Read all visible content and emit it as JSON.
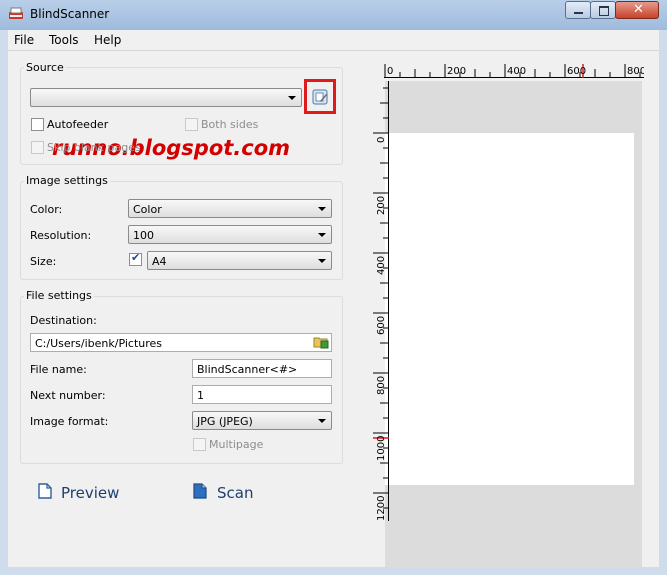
{
  "window": {
    "title": "BlindScanner"
  },
  "menu": [
    "File",
    "Tools",
    "Help"
  ],
  "source": {
    "group_label": "Source",
    "device_value": "",
    "autofeeder_label": "Autofeeder",
    "autofeeder_checked": false,
    "both_sides_label": "Both sides",
    "both_sides_checked": false,
    "skip_blank_label": "Skip blank pages",
    "skip_blank_checked": false
  },
  "image_settings": {
    "group_label": "Image settings",
    "color_label": "Color:",
    "color_value": "Color",
    "resolution_label": "Resolution:",
    "resolution_value": "100",
    "size_label": "Size:",
    "size_checked": true,
    "size_value": "A4"
  },
  "file_settings": {
    "group_label": "File settings",
    "destination_label": "Destination:",
    "destination_value": "C:/Users/ibenk/Pictures",
    "file_name_label": "File name:",
    "file_name_value": "BlindScanner<#>",
    "next_number_label": "Next number:",
    "next_number_value": "1",
    "image_format_label": "Image format:",
    "image_format_value": "JPG (JPEG)",
    "multipage_label": "Multipage",
    "multipage_checked": false
  },
  "actions": {
    "preview_label": "Preview",
    "scan_label": "Scan"
  },
  "ruler": {
    "h_labels": [
      "0",
      "200",
      "400",
      "600",
      "800"
    ],
    "v_labels": [
      "0",
      "200",
      "400",
      "600",
      "800",
      "1000",
      "1200"
    ]
  },
  "watermark": "runno.blogspot.com",
  "colors": {
    "highlight_box": "#e01a1a",
    "watermark": "#d40000",
    "ruler_marker": "#d42020"
  }
}
